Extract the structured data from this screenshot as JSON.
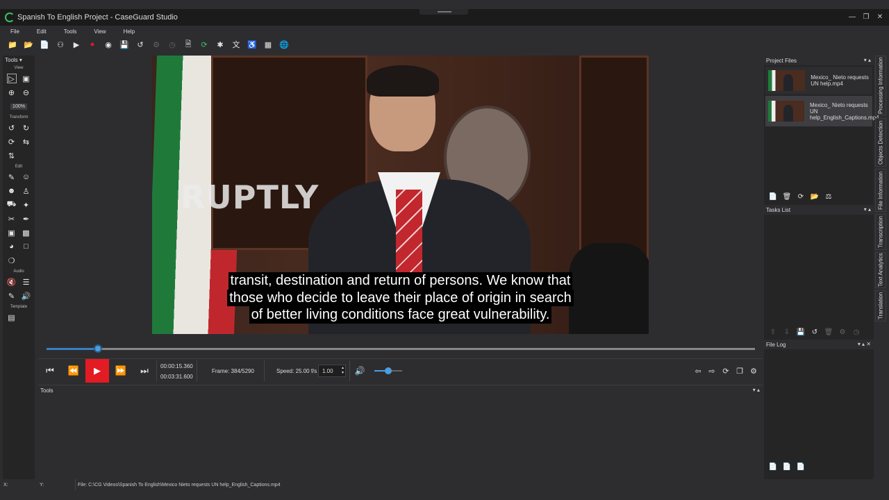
{
  "window": {
    "title": "Spanish To English Project - CaseGuard Studio",
    "controls": [
      "minimize-icon",
      "restore-icon",
      "close-icon"
    ]
  },
  "menu": [
    "File",
    "Edit",
    "Tools",
    "View",
    "Help"
  ],
  "toolbar": [
    "new-project-icon",
    "open-folder-icon",
    "add-file-icon",
    "people-icon",
    "youtube-icon",
    "record-icon",
    "webcam-icon",
    "save-icon",
    "history-icon",
    "settings-disabled-icon",
    "clock-disabled-icon",
    "document-icon",
    "refresh-icon",
    "tools-icon",
    "translate-icon",
    "accessibility-icon",
    "calendar-icon",
    "globe-icon"
  ],
  "left_tools": {
    "header": "Tools",
    "sections": {
      "view": "View",
      "transform": "Transform",
      "edit": "Edit",
      "audio": "Audio",
      "template": "Template"
    },
    "zoom": "100%"
  },
  "video": {
    "watermark": "RUPTLY",
    "subtitle": [
      "transit, destination and return of persons. We know that",
      "those who decide to leave their place of origin in search",
      "of better living conditions face great vulnerability."
    ]
  },
  "timeline": {
    "progress": 0.073
  },
  "playback": {
    "current_time": "00:00:15.360",
    "total_time": "00:03:31.600",
    "frame": "Frame: 384/5290",
    "speed_label": "Speed: 25.00 f/s",
    "speed_value": "1.00",
    "volume": 0.5
  },
  "tools_panel": {
    "title": "Tools"
  },
  "project_files": {
    "title": "Project Files",
    "files": [
      "Mexico_ Nieto requests UN help.mp4",
      "Mexico_ Nieto requests UN help_English_Captions.mp4"
    ]
  },
  "tasks": {
    "title": "Tasks List"
  },
  "file_log": {
    "title": "File Log"
  },
  "side_tabs": [
    "Processing Information",
    "Objects Detection",
    "File Information",
    "Transcription",
    "Text Analytics",
    "Translation"
  ],
  "status": {
    "x": "X:",
    "y": "Y:",
    "file": "File: C:\\CG Videos\\Spanish To English\\Mexico Nieto requests UN help_English_Captions.mp4"
  }
}
